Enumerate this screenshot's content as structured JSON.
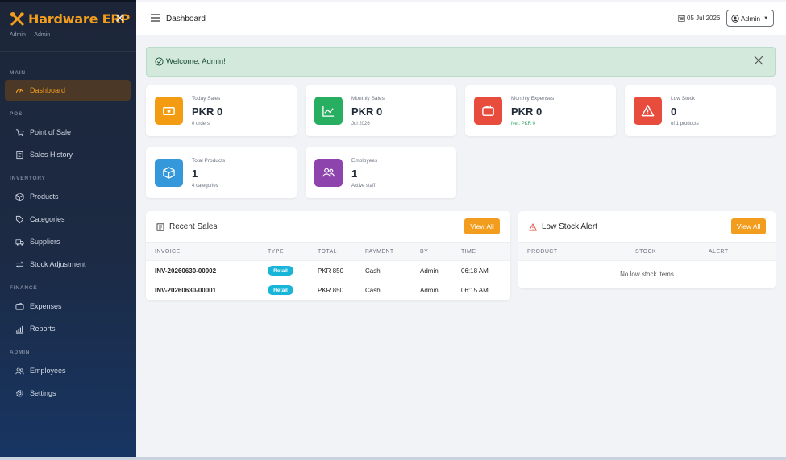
{
  "sidebar": {
    "brand_title": "Hardware ERP",
    "brand_sub": "Admin — Admin",
    "sections": {
      "main": "MAIN",
      "pos": "POS",
      "inventory": "INVENTORY",
      "finance": "FINANCE",
      "admin": "ADMIN"
    },
    "items": [
      {
        "label": "Dashboard",
        "icon": "speedometer-icon",
        "active": true
      },
      {
        "label": "Point of Sale",
        "icon": "cart-icon"
      },
      {
        "label": "Sales History",
        "icon": "receipt-icon"
      },
      {
        "label": "Products",
        "icon": "box-icon"
      },
      {
        "label": "Categories",
        "icon": "tag-icon"
      },
      {
        "label": "Suppliers",
        "icon": "truck-icon"
      },
      {
        "label": "Stock Adjustment",
        "icon": "arrows-icon"
      },
      {
        "label": "Expenses",
        "icon": "wallet-icon"
      },
      {
        "label": "Reports",
        "icon": "bar-chart-icon"
      },
      {
        "label": "Employees",
        "icon": "people-icon"
      },
      {
        "label": "Settings",
        "icon": "gear-icon"
      }
    ]
  },
  "topbar": {
    "title": "Dashboard",
    "date": "05 Jul 2026",
    "user": "Admin"
  },
  "welcome": {
    "text": "Welcome, Admin!"
  },
  "cards": [
    {
      "label": "Today Sales",
      "value": "PKR 0",
      "sub": "0 orders",
      "color": "#f39c12"
    },
    {
      "label": "Monthly Sales",
      "value": "PKR 0",
      "sub": "Jul 2026",
      "color": "#27ae60"
    },
    {
      "label": "Monthly Expenses",
      "value": "PKR 0",
      "sub": "Net: PKR 0",
      "color": "#e74c3c"
    },
    {
      "label": "Low Stock",
      "value": "0",
      "sub": "of 1 products",
      "color": "#e74c3c"
    },
    {
      "label": "Total Products",
      "value": "1",
      "sub": "4 categories",
      "color": "#3498db"
    },
    {
      "label": "Employees",
      "value": "1",
      "sub": "Active staff",
      "color": "#8e44ad"
    }
  ],
  "recent_sales": {
    "title": "Recent Sales",
    "view_all": "View All",
    "columns": [
      "INVOICE",
      "TYPE",
      "TOTAL",
      "PAYMENT",
      "BY",
      "TIME"
    ],
    "rows": [
      {
        "invoice": "INV-20260630-00002",
        "type": "Retail",
        "total": "PKR 850",
        "payment": "Cash",
        "by": "Admin",
        "time": "06:18 AM"
      },
      {
        "invoice": "INV-20260630-00001",
        "type": "Retail",
        "total": "PKR 850",
        "payment": "Cash",
        "by": "Admin",
        "time": "06:15 AM"
      }
    ]
  },
  "low_stock": {
    "title": "Low Stock Alert",
    "view_all": "View All",
    "columns": [
      "PRODUCT",
      "STOCK",
      "ALERT"
    ],
    "empty_text": "No low stock items"
  },
  "colors": {
    "accent": "#f29d1e",
    "success_bg": "#d2e9dc",
    "badge": "#19b5d8"
  }
}
